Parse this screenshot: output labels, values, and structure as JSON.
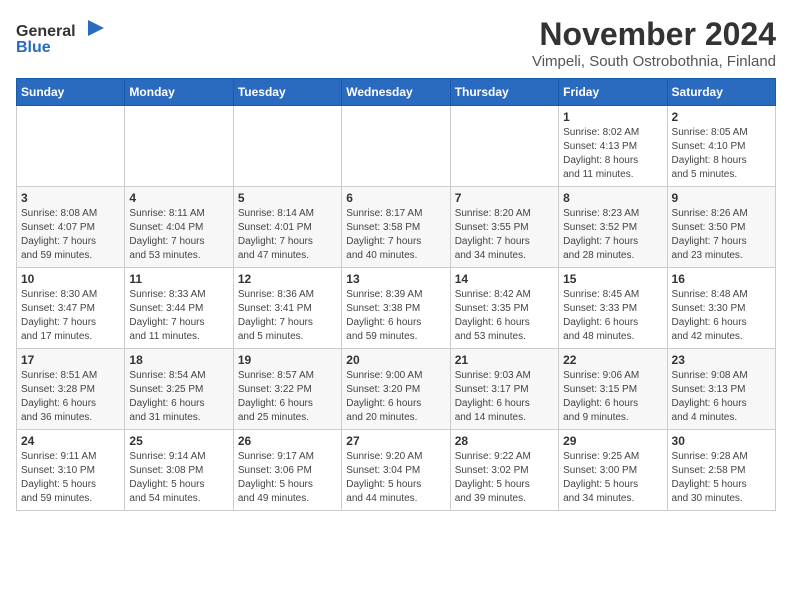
{
  "header": {
    "logo_general": "General",
    "logo_blue": "Blue",
    "title": "November 2024",
    "subtitle": "Vimpeli, South Ostrobothnia, Finland"
  },
  "weekdays": [
    "Sunday",
    "Monday",
    "Tuesday",
    "Wednesday",
    "Thursday",
    "Friday",
    "Saturday"
  ],
  "weeks": [
    [
      {
        "day": "",
        "info": ""
      },
      {
        "day": "",
        "info": ""
      },
      {
        "day": "",
        "info": ""
      },
      {
        "day": "",
        "info": ""
      },
      {
        "day": "",
        "info": ""
      },
      {
        "day": "1",
        "info": "Sunrise: 8:02 AM\nSunset: 4:13 PM\nDaylight: 8 hours\nand 11 minutes."
      },
      {
        "day": "2",
        "info": "Sunrise: 8:05 AM\nSunset: 4:10 PM\nDaylight: 8 hours\nand 5 minutes."
      }
    ],
    [
      {
        "day": "3",
        "info": "Sunrise: 8:08 AM\nSunset: 4:07 PM\nDaylight: 7 hours\nand 59 minutes."
      },
      {
        "day": "4",
        "info": "Sunrise: 8:11 AM\nSunset: 4:04 PM\nDaylight: 7 hours\nand 53 minutes."
      },
      {
        "day": "5",
        "info": "Sunrise: 8:14 AM\nSunset: 4:01 PM\nDaylight: 7 hours\nand 47 minutes."
      },
      {
        "day": "6",
        "info": "Sunrise: 8:17 AM\nSunset: 3:58 PM\nDaylight: 7 hours\nand 40 minutes."
      },
      {
        "day": "7",
        "info": "Sunrise: 8:20 AM\nSunset: 3:55 PM\nDaylight: 7 hours\nand 34 minutes."
      },
      {
        "day": "8",
        "info": "Sunrise: 8:23 AM\nSunset: 3:52 PM\nDaylight: 7 hours\nand 28 minutes."
      },
      {
        "day": "9",
        "info": "Sunrise: 8:26 AM\nSunset: 3:50 PM\nDaylight: 7 hours\nand 23 minutes."
      }
    ],
    [
      {
        "day": "10",
        "info": "Sunrise: 8:30 AM\nSunset: 3:47 PM\nDaylight: 7 hours\nand 17 minutes."
      },
      {
        "day": "11",
        "info": "Sunrise: 8:33 AM\nSunset: 3:44 PM\nDaylight: 7 hours\nand 11 minutes."
      },
      {
        "day": "12",
        "info": "Sunrise: 8:36 AM\nSunset: 3:41 PM\nDaylight: 7 hours\nand 5 minutes."
      },
      {
        "day": "13",
        "info": "Sunrise: 8:39 AM\nSunset: 3:38 PM\nDaylight: 6 hours\nand 59 minutes."
      },
      {
        "day": "14",
        "info": "Sunrise: 8:42 AM\nSunset: 3:35 PM\nDaylight: 6 hours\nand 53 minutes."
      },
      {
        "day": "15",
        "info": "Sunrise: 8:45 AM\nSunset: 3:33 PM\nDaylight: 6 hours\nand 48 minutes."
      },
      {
        "day": "16",
        "info": "Sunrise: 8:48 AM\nSunset: 3:30 PM\nDaylight: 6 hours\nand 42 minutes."
      }
    ],
    [
      {
        "day": "17",
        "info": "Sunrise: 8:51 AM\nSunset: 3:28 PM\nDaylight: 6 hours\nand 36 minutes."
      },
      {
        "day": "18",
        "info": "Sunrise: 8:54 AM\nSunset: 3:25 PM\nDaylight: 6 hours\nand 31 minutes."
      },
      {
        "day": "19",
        "info": "Sunrise: 8:57 AM\nSunset: 3:22 PM\nDaylight: 6 hours\nand 25 minutes."
      },
      {
        "day": "20",
        "info": "Sunrise: 9:00 AM\nSunset: 3:20 PM\nDaylight: 6 hours\nand 20 minutes."
      },
      {
        "day": "21",
        "info": "Sunrise: 9:03 AM\nSunset: 3:17 PM\nDaylight: 6 hours\nand 14 minutes."
      },
      {
        "day": "22",
        "info": "Sunrise: 9:06 AM\nSunset: 3:15 PM\nDaylight: 6 hours\nand 9 minutes."
      },
      {
        "day": "23",
        "info": "Sunrise: 9:08 AM\nSunset: 3:13 PM\nDaylight: 6 hours\nand 4 minutes."
      }
    ],
    [
      {
        "day": "24",
        "info": "Sunrise: 9:11 AM\nSunset: 3:10 PM\nDaylight: 5 hours\nand 59 minutes."
      },
      {
        "day": "25",
        "info": "Sunrise: 9:14 AM\nSunset: 3:08 PM\nDaylight: 5 hours\nand 54 minutes."
      },
      {
        "day": "26",
        "info": "Sunrise: 9:17 AM\nSunset: 3:06 PM\nDaylight: 5 hours\nand 49 minutes."
      },
      {
        "day": "27",
        "info": "Sunrise: 9:20 AM\nSunset: 3:04 PM\nDaylight: 5 hours\nand 44 minutes."
      },
      {
        "day": "28",
        "info": "Sunrise: 9:22 AM\nSunset: 3:02 PM\nDaylight: 5 hours\nand 39 minutes."
      },
      {
        "day": "29",
        "info": "Sunrise: 9:25 AM\nSunset: 3:00 PM\nDaylight: 5 hours\nand 34 minutes."
      },
      {
        "day": "30",
        "info": "Sunrise: 9:28 AM\nSunset: 2:58 PM\nDaylight: 5 hours\nand 30 minutes."
      }
    ]
  ]
}
